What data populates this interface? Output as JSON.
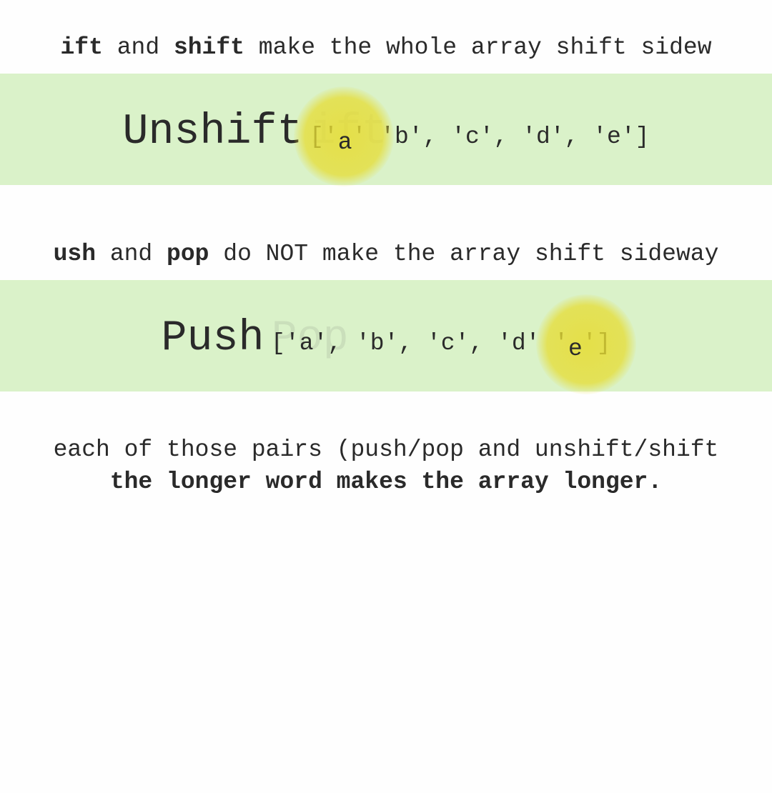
{
  "sentence1": {
    "leading_bold_fragment": "ift",
    "mid1": " and ",
    "bold2": "shift",
    "tail": " make the whole array shift sidew"
  },
  "panel1": {
    "title": "Unshift",
    "ghost": "ift",
    "array_open": "['",
    "moved": "a",
    "array_rest": "'  'b', 'c', 'd', 'e']"
  },
  "sentence2": {
    "leading_bold_fragment": "ush",
    "mid1": " and ",
    "bold2": "pop",
    "tail": " do NOT make the array shift sideway"
  },
  "panel2": {
    "title": "Push",
    "ghost": "Pop",
    "array_head": "['a', 'b', 'c', 'd'  '",
    "moved": "e",
    "array_close": "']"
  },
  "footer": {
    "line1": "each of those pairs (push/pop and unshift/shift",
    "line2": "the longer word makes the array longer."
  }
}
